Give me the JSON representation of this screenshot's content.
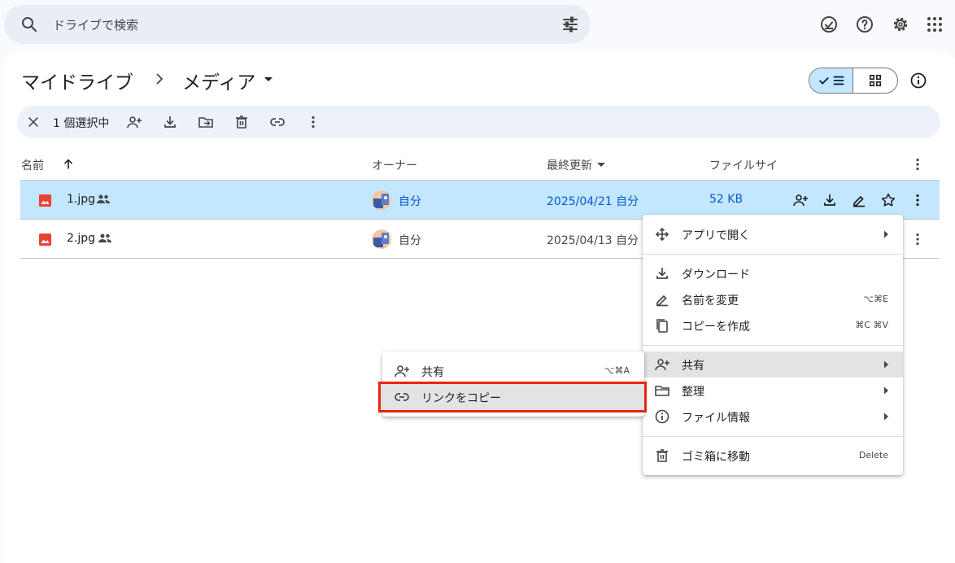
{
  "search": {
    "placeholder": "ドライブで検索"
  },
  "breadcrumb": {
    "root": "マイドライブ",
    "current": "メディア"
  },
  "selection": {
    "count_label": "1 個選択中"
  },
  "table": {
    "columns": {
      "name": "名前",
      "owner": "オーナー",
      "modified": "最終更新",
      "size": "ファイルサイ"
    },
    "rows": [
      {
        "name": "1.jpg",
        "owner": "自分",
        "modified": "2025/04/21 自分",
        "size": "52 KB"
      },
      {
        "name": "2.jpg",
        "owner": "自分",
        "modified": "2025/04/13 自分"
      }
    ]
  },
  "menu": {
    "open_with": "アプリで開く",
    "download": "ダウンロード",
    "rename": "名前を変更",
    "rename_shortcut": "⌥⌘E",
    "copy": "コピーを作成",
    "copy_shortcut": "⌘C ⌘V",
    "share": "共有",
    "organize": "整理",
    "file_info": "ファイル情報",
    "trash": "ゴミ箱に移動",
    "trash_shortcut": "Delete"
  },
  "submenu": {
    "share": "共有",
    "share_shortcut": "⌥⌘A",
    "copy_link": "リンクをコピー"
  },
  "colors": {
    "accent": "#0b57d0",
    "selected_row": "#c2e7ff",
    "highlight_box": "#e8250c",
    "image_icon": "#ea4335"
  }
}
